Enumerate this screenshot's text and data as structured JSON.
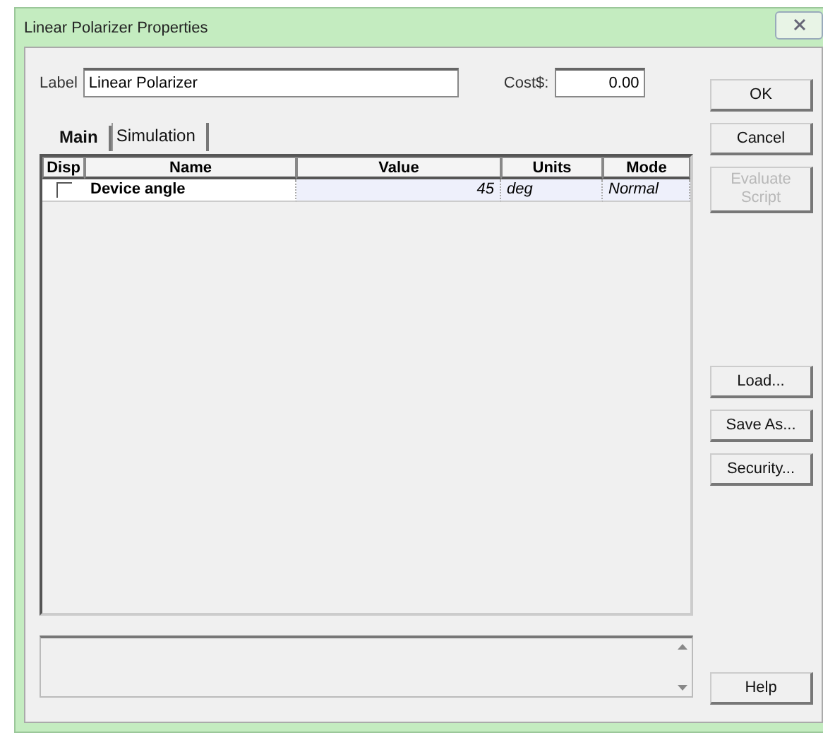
{
  "window": {
    "title": "Linear Polarizer Properties"
  },
  "label_field": {
    "label": "Label",
    "value": "Linear Polarizer"
  },
  "cost_field": {
    "label": "Cost$:",
    "value": "0.00"
  },
  "tabs": [
    {
      "label": "Main",
      "selected": true
    },
    {
      "label": "Simulation",
      "selected": false
    }
  ],
  "table": {
    "columns": [
      "Disp",
      "Name",
      "Value",
      "Units",
      "Mode"
    ],
    "rows": [
      {
        "checked": false,
        "name": "Device angle",
        "value": "45",
        "units": "deg",
        "mode": "Normal"
      }
    ]
  },
  "top_buttons": [
    {
      "label": "OK",
      "disabled": false
    },
    {
      "label": "Cancel",
      "disabled": false
    },
    {
      "label": "Evaluate Script",
      "disabled": true
    }
  ],
  "middle_buttons": [
    {
      "label": "Load...",
      "disabled": false
    },
    {
      "label": "Save As...",
      "disabled": false
    },
    {
      "label": "Security...",
      "disabled": false
    }
  ],
  "bottom_buttons": [
    {
      "label": "Help",
      "disabled": false
    }
  ]
}
